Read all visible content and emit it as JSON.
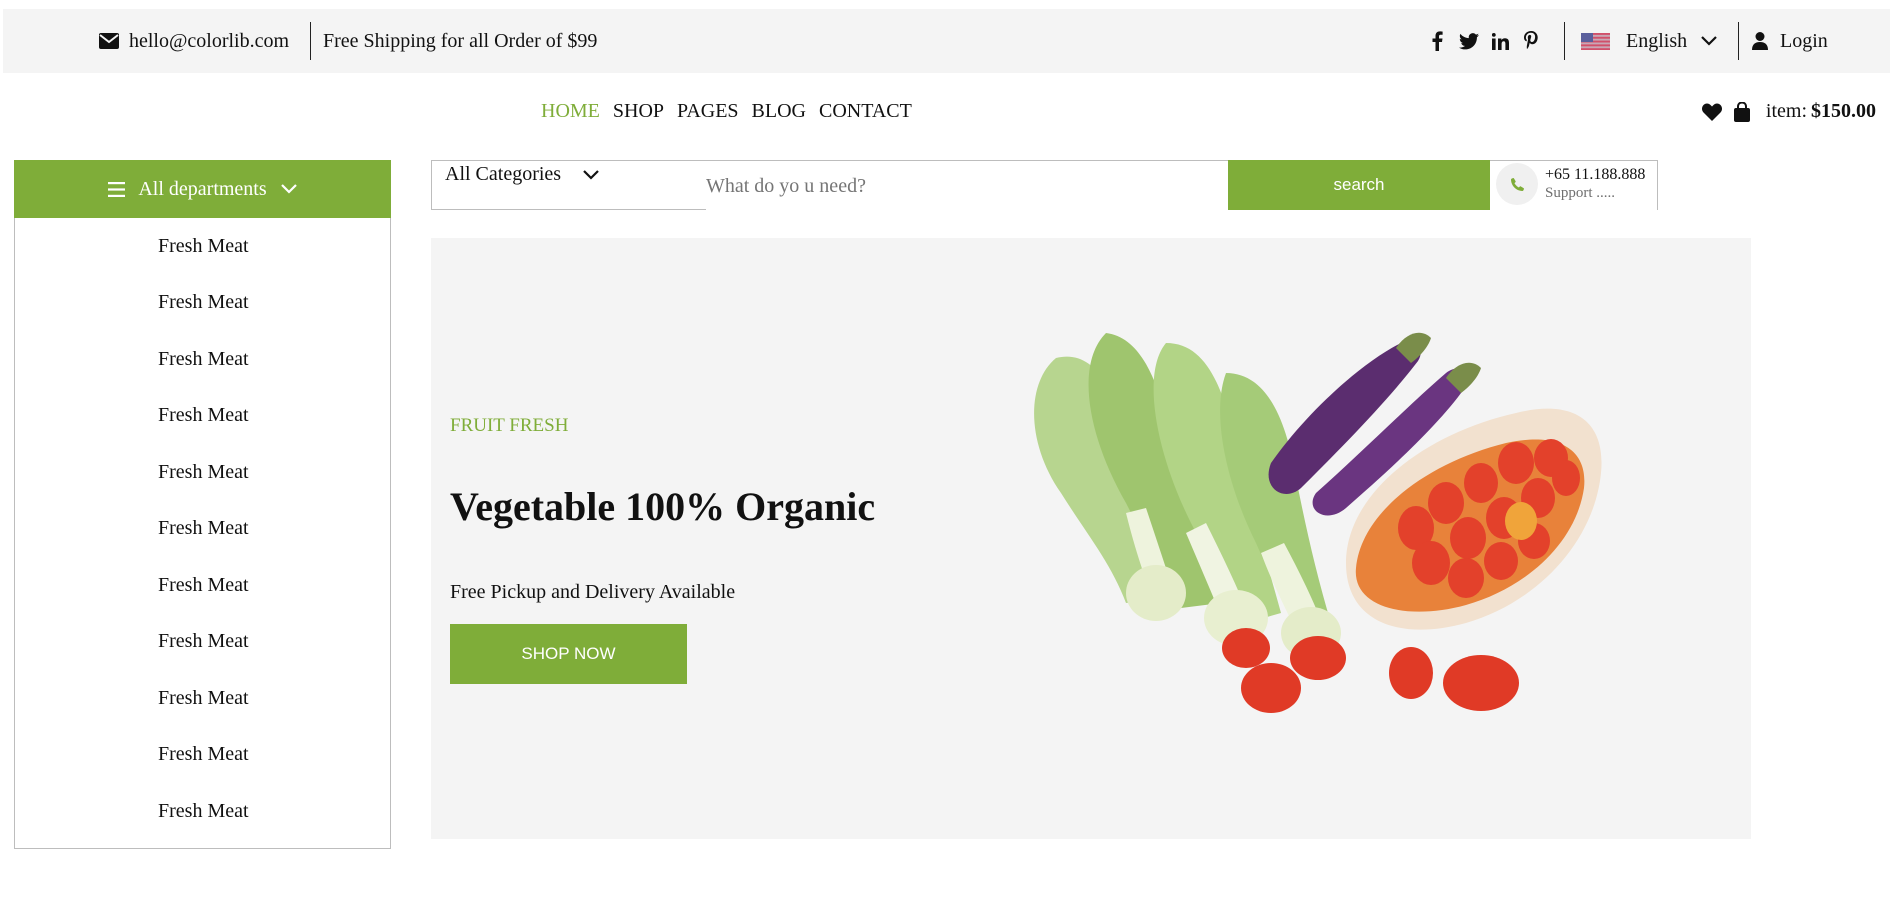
{
  "topbar": {
    "email": "hello@colorlib.com",
    "shipping": "Free Shipping for all Order of $99",
    "social_icons": [
      "facebook-icon",
      "twitter-icon",
      "linkedin-icon",
      "pinterest-icon"
    ],
    "language": "English",
    "login": "Login"
  },
  "nav": {
    "items": [
      "HOME",
      "SHOP",
      "PAGES",
      "BLOG",
      "CONTACT"
    ],
    "active": "HOME"
  },
  "cart": {
    "label": "item:",
    "price": "$150.00"
  },
  "departments": {
    "title": "All departments",
    "items": [
      "Fresh Meat",
      "Fresh Meat",
      "Fresh Meat",
      "Fresh Meat",
      "Fresh Meat",
      "Fresh Meat",
      "Fresh Meat",
      "Fresh Meat",
      "Fresh Meat",
      "Fresh Meat",
      "Fresh Meat"
    ]
  },
  "search": {
    "category": "All Categories",
    "placeholder": "What do yo u need?",
    "button": "search"
  },
  "phone": {
    "number": "+65 11.188.888",
    "support": "Support ....."
  },
  "hero": {
    "eyebrow": "FRUIT FRESH",
    "title": "Vegetable 100% Organic",
    "subtitle": "Free Pickup and Delivery Available",
    "button": "SHOP NOW"
  },
  "colors": {
    "accent": "#7fad39",
    "topbar_bg": "#f4f4f4",
    "hero_bg": "#f4f4f4"
  }
}
